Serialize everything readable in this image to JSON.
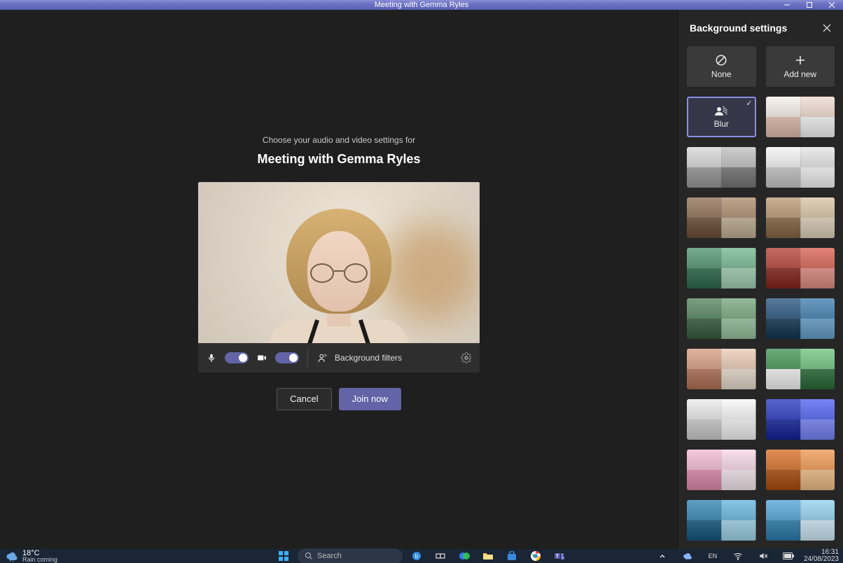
{
  "window": {
    "title": "Meeting with Gemma Ryles"
  },
  "stage": {
    "prompt": "Choose your audio and video settings for",
    "meeting_title": "Meeting with Gemma Ryles",
    "controls": {
      "mic_on": true,
      "camera_on": true,
      "background_filters_label": "Background filters"
    },
    "actions": {
      "cancel": "Cancel",
      "join": "Join now"
    }
  },
  "sidepanel": {
    "title": "Background settings",
    "none_label": "None",
    "addnew_label": "Add new",
    "blur_label": "Blur",
    "selected": "blur",
    "backgrounds": [
      "room-white-pink",
      "loft-grey",
      "studio-white-arch",
      "living-warm",
      "kitchen-wood",
      "patio-glass",
      "lounge-red",
      "hall-green",
      "cave-blue",
      "arch-desert",
      "portal-green",
      "gallery-white",
      "corridor-blue",
      "blossom-pink",
      "autumn-orange",
      "abstract-underwater",
      "abstract-bubbles"
    ]
  },
  "taskbar": {
    "temperature": "18°C",
    "weather_sub": "Rain coming",
    "search_placeholder": "Search",
    "time": "16:31",
    "date": "24/08/2023"
  },
  "icons": {
    "bg_thumbnails": {
      "room-white-pink": [
        [
          "#f5efe8",
          "#f0d9cd"
        ],
        [
          "#e9c4b4",
          "#ffffff"
        ]
      ],
      "loft-grey": [
        [
          "#d6d6d6",
          "#bdbdbd"
        ],
        [
          "#9e9e9e",
          "#7a7a7a"
        ]
      ],
      "studio-white-arch": [
        [
          "#f2f2f2",
          "#e3e3e3"
        ],
        [
          "#cfcfcf",
          "#ffffff"
        ]
      ],
      "living-warm": [
        [
          "#8a6a4e",
          "#a98867"
        ],
        [
          "#6e5038",
          "#c9b69a"
        ]
      ],
      "kitchen-wood": [
        [
          "#b99570",
          "#d8c2a3"
        ],
        [
          "#8c6a46",
          "#e8dac4"
        ]
      ],
      "patio-glass": [
        [
          "#4a8f6b",
          "#6fb58b"
        ],
        [
          "#2e6e4c",
          "#a8d7bb"
        ]
      ],
      "lounge-red": [
        [
          "#b23a2e",
          "#d65a4b"
        ],
        [
          "#8a241a",
          "#e89288"
        ]
      ],
      "hall-green": [
        [
          "#4f7f58",
          "#6fa377"
        ],
        [
          "#37603f",
          "#9cc9a3"
        ]
      ],
      "cave-blue": [
        [
          "#1f4e78",
          "#3a79ab"
        ],
        [
          "#123756",
          "#6aa6d1"
        ]
      ],
      "arch-desert": [
        [
          "#d79a7e",
          "#e9c8b1"
        ],
        [
          "#b8745a",
          "#f1e5d7"
        ]
      ],
      "portal-green": [
        [
          "#3d8f4e",
          "#6cc07a"
        ],
        [
          "#ffffff",
          "#2c6e39"
        ]
      ],
      "gallery-white": [
        [
          "#eaeaea",
          "#f7f7f7"
        ],
        [
          "#d5d5d5",
          "#ffffff"
        ]
      ],
      "corridor-blue": [
        [
          "#2030c0",
          "#4a5cf0"
        ],
        [
          "#1422a0",
          "#7a88ff"
        ]
      ],
      "blossom-pink": [
        [
          "#f2b8cf",
          "#f7d6e3"
        ],
        [
          "#e88fb6",
          "#fff0f6"
        ]
      ],
      "autumn-orange": [
        [
          "#d76a1e",
          "#ef954a"
        ],
        [
          "#b24f0d",
          "#f8c58e"
        ]
      ],
      "abstract-underwater": [
        [
          "#2a7fb0",
          "#5fb3dd"
        ],
        [
          "#135a85",
          "#a5dcf2"
        ]
      ],
      "abstract-bubbles": [
        [
          "#4aa0d5",
          "#8fd0ef"
        ],
        [
          "#2b7fb3",
          "#d6f2ff"
        ]
      ]
    }
  }
}
